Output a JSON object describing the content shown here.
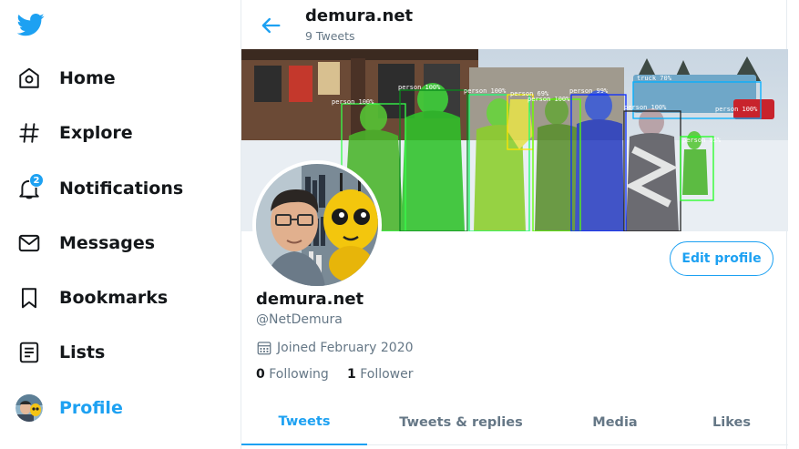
{
  "colors": {
    "accent": "#1da1f2",
    "text": "#14171a",
    "muted": "#657786",
    "border": "#e6ecf0"
  },
  "sidebar": {
    "logo_icon": "twitter-bird-icon",
    "items": [
      {
        "label": "Home",
        "icon": "home-icon"
      },
      {
        "label": "Explore",
        "icon": "hashtag-icon"
      },
      {
        "label": "Notifications",
        "icon": "bell-icon",
        "badge": "2"
      },
      {
        "label": "Messages",
        "icon": "envelope-icon"
      },
      {
        "label": "Bookmarks",
        "icon": "bookmark-icon"
      },
      {
        "label": "Lists",
        "icon": "list-icon"
      },
      {
        "label": "Profile",
        "icon": "avatar",
        "active": true
      }
    ]
  },
  "header": {
    "title": "demura.net",
    "subtitle": "9 Tweets"
  },
  "banner": {
    "detections": [
      "person 100%",
      "person 100%",
      "person 100%",
      "person 69%",
      "person 100%",
      "truck 70%",
      "person 100%",
      "person 99%",
      "person 100%",
      "person 95%"
    ]
  },
  "profile": {
    "edit_label": "Edit profile",
    "name": "demura.net",
    "handle": "@NetDemura",
    "joined": "Joined February 2020",
    "following_count": "0",
    "following_label": "Following",
    "followers_count": "1",
    "followers_label": "Follower"
  },
  "tabs": [
    {
      "label": "Tweets",
      "active": true
    },
    {
      "label": "Tweets & replies"
    },
    {
      "label": "Media"
    },
    {
      "label": "Likes"
    }
  ]
}
